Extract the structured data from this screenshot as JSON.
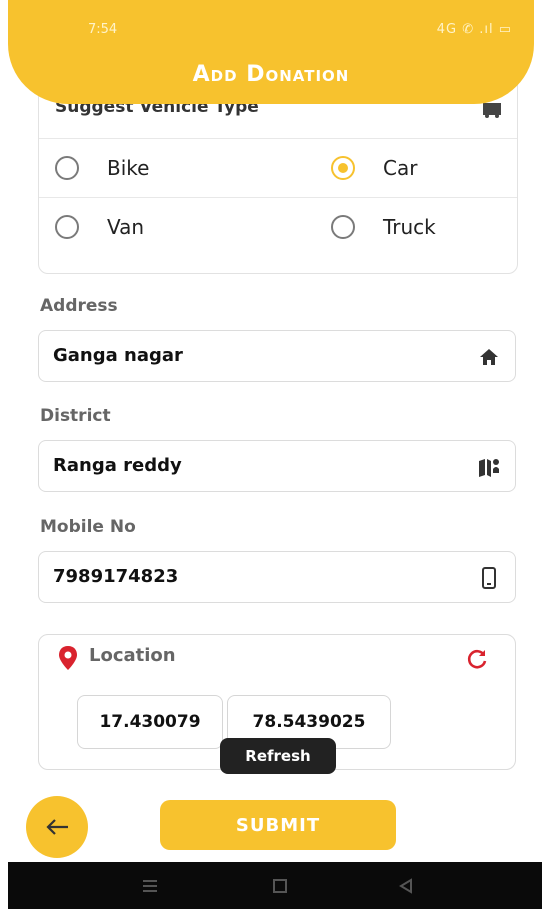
{
  "status_bar": {
    "time": "7:54",
    "icons": "4G ✆ .ıl ▭"
  },
  "header": {
    "title": "Add Donation"
  },
  "vehicle": {
    "heading": "Suggest Vehicle Type",
    "options": [
      {
        "label": "Bike",
        "checked": false
      },
      {
        "label": "Car",
        "checked": true
      },
      {
        "label": "Van",
        "checked": false
      },
      {
        "label": "Truck",
        "checked": false
      }
    ]
  },
  "address": {
    "label": "Address",
    "value": "Ganga nagar",
    "icon": "home-icon"
  },
  "district": {
    "label": "District",
    "value": "Ranga reddy",
    "icon": "map-icon"
  },
  "mobile": {
    "label": "Mobile No",
    "value": "7989174823",
    "icon": "phone-icon"
  },
  "location": {
    "title": "Location",
    "latitude": "17.430079",
    "longitude": "78.5439025",
    "tooltip": "Refresh"
  },
  "actions": {
    "submit_label": "SUBMIT"
  },
  "colors": {
    "accent": "#f7c22e",
    "pin": "#d9232e"
  }
}
